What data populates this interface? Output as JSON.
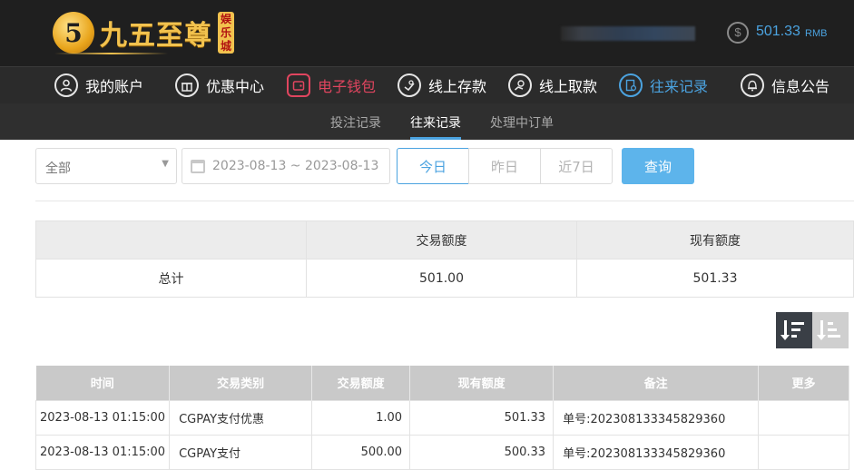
{
  "header": {
    "logo_text": "九五至尊",
    "logo_tag": "娱乐城",
    "balance_icon": "$",
    "balance_amount": "501.33",
    "balance_unit": "RMB"
  },
  "nav": [
    {
      "label": "我的账户",
      "icon": "user-icon"
    },
    {
      "label": "优惠中心",
      "icon": "gift-icon"
    },
    {
      "label": "电子钱包",
      "icon": "wallet-icon"
    },
    {
      "label": "线上存款",
      "icon": "deposit-icon"
    },
    {
      "label": "线上取款",
      "icon": "withdraw-icon"
    },
    {
      "label": "往来记录",
      "icon": "records-icon"
    },
    {
      "label": "信息公告",
      "icon": "bell-icon"
    }
  ],
  "subnav": [
    "投注记录",
    "往来记录",
    "处理中订单"
  ],
  "filters": {
    "type_value": "全部",
    "date_range": "2023-08-13 ~ 2023-08-13",
    "today": "今日",
    "yesterday": "昨日",
    "last7": "近7日",
    "query": "查询"
  },
  "summary": {
    "col_amount": "交易额度",
    "col_balance": "现有额度",
    "row_label": "总计",
    "amount": "501.00",
    "balance": "501.33"
  },
  "records": {
    "columns": [
      "时间",
      "交易类别",
      "交易额度",
      "现有额度",
      "备注",
      "更多"
    ],
    "rows": [
      [
        "2023-08-13 01:15:00",
        "CGPAY支付优惠",
        "1.00",
        "501.33",
        "单号:202308133345829360",
        ""
      ],
      [
        "2023-08-13 01:15:00",
        "CGPAY支付",
        "500.00",
        "500.33",
        "单号:202308133345829360",
        ""
      ]
    ]
  },
  "colors": {
    "accent_blue": "#4ba3e0",
    "active_red": "#e0455f",
    "logo_gold": "#f2c24e"
  }
}
